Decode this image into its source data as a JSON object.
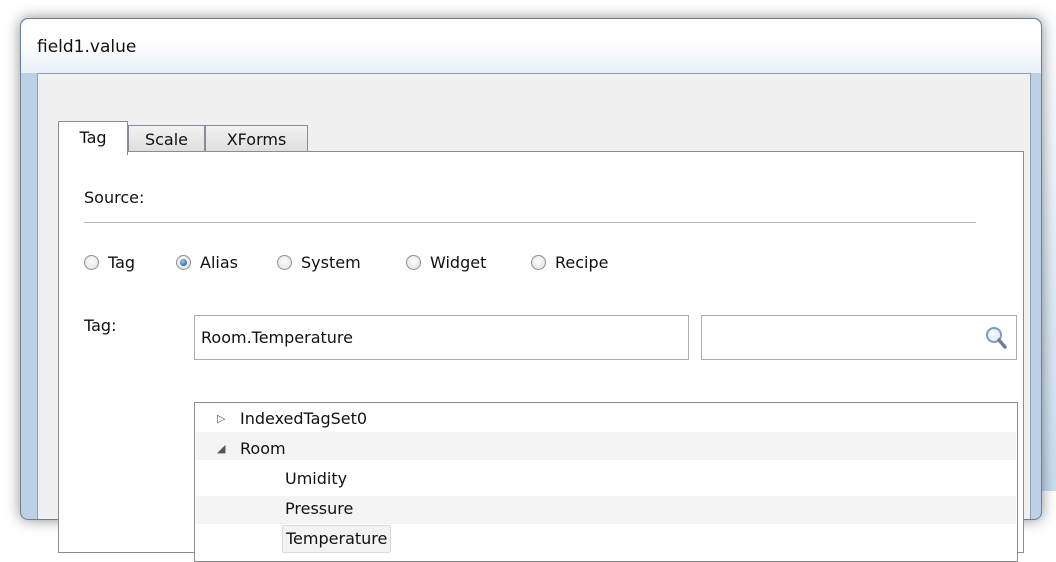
{
  "window": {
    "title": "field1.value"
  },
  "tabs": [
    {
      "label": "Tag",
      "active": true
    },
    {
      "label": "Scale",
      "active": false
    },
    {
      "label": "XForms",
      "active": false
    }
  ],
  "source": {
    "label": "Source:",
    "options": [
      {
        "label": "Tag",
        "selected": false
      },
      {
        "label": "Alias",
        "selected": true
      },
      {
        "label": "System",
        "selected": false
      },
      {
        "label": "Widget",
        "selected": false
      },
      {
        "label": "Recipe",
        "selected": false
      }
    ]
  },
  "tag_field": {
    "label": "Tag:",
    "value": "Room.Temperature",
    "search_value": "",
    "search_icon": "magnifier-icon"
  },
  "tree": [
    {
      "label": "IndexedTagSet0",
      "expanded": false,
      "icon": "collapsed-triangle"
    },
    {
      "label": "Room",
      "expanded": true,
      "icon": "expanded-triangle",
      "children": [
        {
          "label": "Umidity"
        },
        {
          "label": "Pressure"
        },
        {
          "label": "Temperature",
          "selected": true
        }
      ]
    }
  ],
  "colors": {
    "selection": "#f3f3f3",
    "radio_on": "#3b78be",
    "frame": "#bcd0e6"
  }
}
